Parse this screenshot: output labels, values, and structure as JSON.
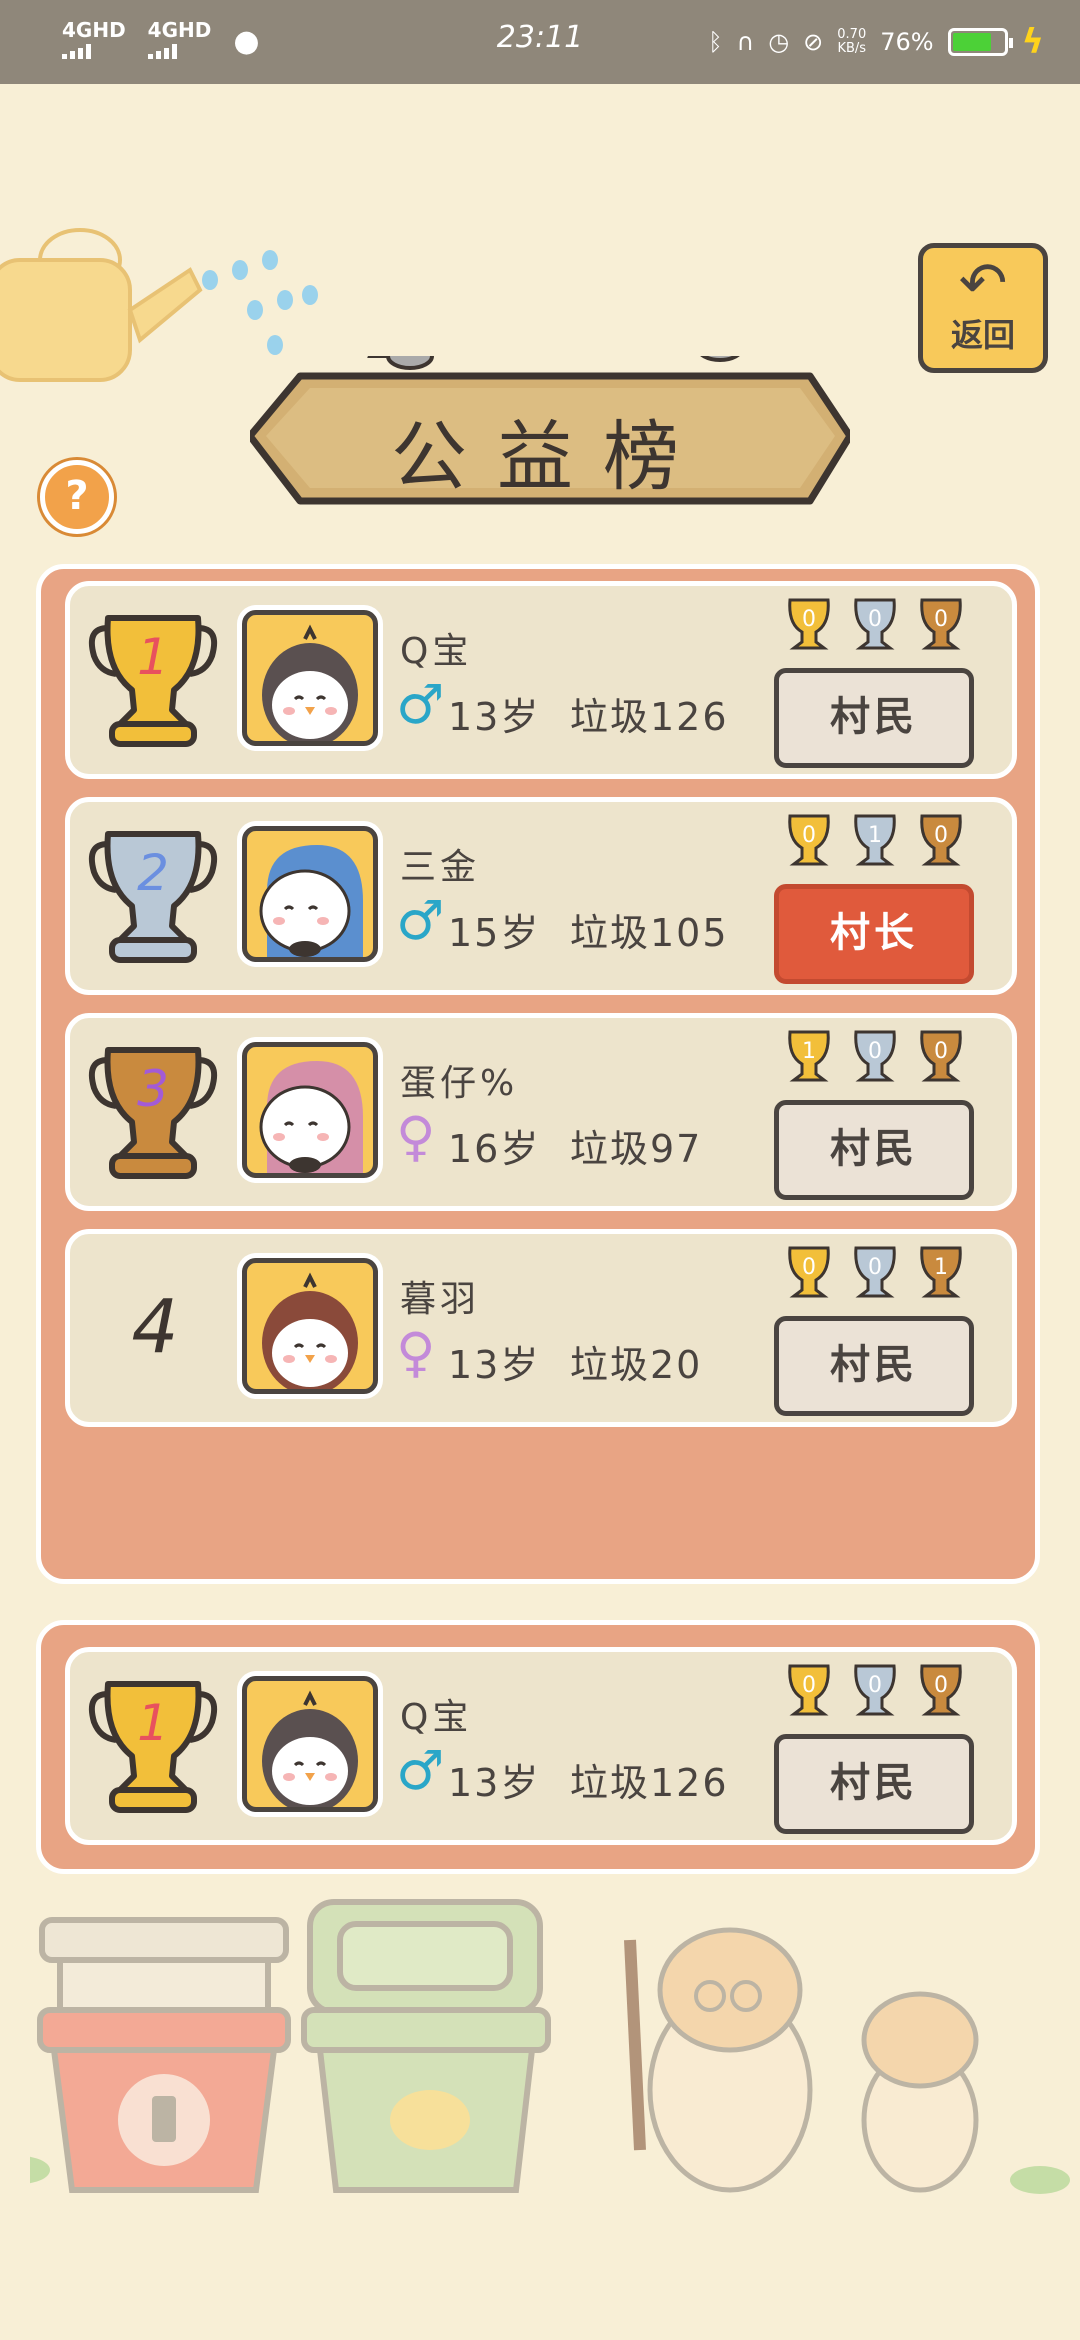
{
  "status_bar": {
    "signal_1": "4GHD",
    "signal_2": "4GHD",
    "time": "23:11",
    "net_speed_value": "0.70",
    "net_speed_unit": "KB/s",
    "battery_pct": "76%"
  },
  "header": {
    "title": "公益榜",
    "back_label": "返回",
    "help_label": "?"
  },
  "leaderboard": [
    {
      "rank": "1",
      "name": "Q宝",
      "gender": "♂",
      "age": "13岁",
      "trash": "垃圾126",
      "role": "村民",
      "mini_trophies": [
        "0",
        "0",
        "0"
      ],
      "avatar": "penguin"
    },
    {
      "rank": "2",
      "name": "三金",
      "gender": "♂",
      "age": "15岁",
      "trash": "垃圾105",
      "role": "村长",
      "mini_trophies": [
        "0",
        "1",
        "0"
      ],
      "avatar": "hedgehog-blue"
    },
    {
      "rank": "3",
      "name": "蛋仔%",
      "gender": "♀",
      "age": "16岁",
      "trash": "垃圾97",
      "role": "村民",
      "mini_trophies": [
        "1",
        "0",
        "0"
      ],
      "avatar": "hedgehog-pink"
    },
    {
      "rank": "4",
      "name": "暮羽",
      "gender": "♀",
      "age": "13岁",
      "trash": "垃圾20",
      "role": "村民",
      "mini_trophies": [
        "0",
        "0",
        "1"
      ],
      "avatar": "penguin-brown"
    }
  ],
  "my_entry": {
    "rank": "1",
    "name": "Q宝",
    "gender": "♂",
    "age": "13岁",
    "trash": "垃圾126",
    "role": "村民",
    "mini_trophies": [
      "0",
      "0",
      "0"
    ]
  },
  "colors": {
    "gold": "#f2bf3a",
    "silver": "#b9c8d6",
    "bronze": "#c98a3e",
    "chief": "#e05a3c",
    "panel": "#e8a484"
  }
}
